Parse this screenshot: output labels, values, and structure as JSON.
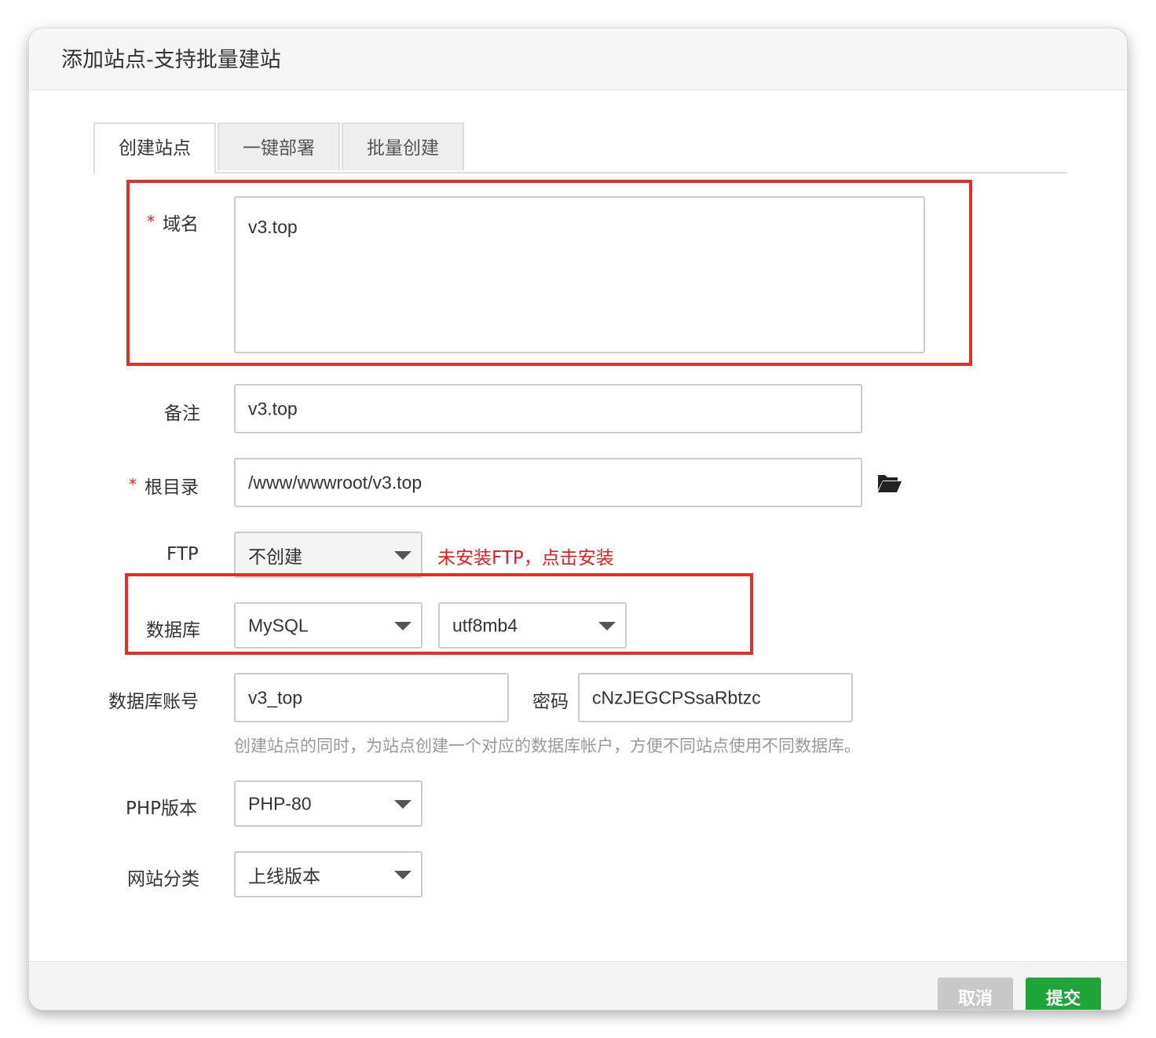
{
  "dialog": {
    "title": "添加站点-支持批量建站"
  },
  "tabs": [
    {
      "label": "创建站点",
      "active": true
    },
    {
      "label": "一键部署",
      "active": false
    },
    {
      "label": "批量创建",
      "active": false
    }
  ],
  "form": {
    "domain": {
      "label": "域名",
      "required_mark": "*",
      "value": "v3.top"
    },
    "remark": {
      "label": "备注",
      "value": "v3.top"
    },
    "root": {
      "label": "根目录",
      "required_mark": "*",
      "value": "/www/wwwroot/v3.top",
      "icon": "folder-open-icon"
    },
    "ftp": {
      "label": "FTP",
      "value": "不创建",
      "warning": "未安装FTP，点击安装"
    },
    "database": {
      "label": "数据库",
      "type_value": "MySQL",
      "charset_value": "utf8mb4"
    },
    "db_account": {
      "label": "数据库账号",
      "value": "v3_top",
      "password_label": "密码",
      "password_value": "cNzJEGCPSsaRbtzc",
      "hint": "创建站点的同时，为站点创建一个对应的数据库帐户，方便不同站点使用不同数据库。"
    },
    "php": {
      "label": "PHP版本",
      "value": "PHP-80"
    },
    "category": {
      "label": "网站分类",
      "value": "上线版本"
    }
  },
  "footer": {
    "cancel_label": "取消",
    "submit_label": "提交"
  },
  "colors": {
    "accent": "#20a53a",
    "highlight": "#e03127",
    "warning": "#e02020"
  }
}
